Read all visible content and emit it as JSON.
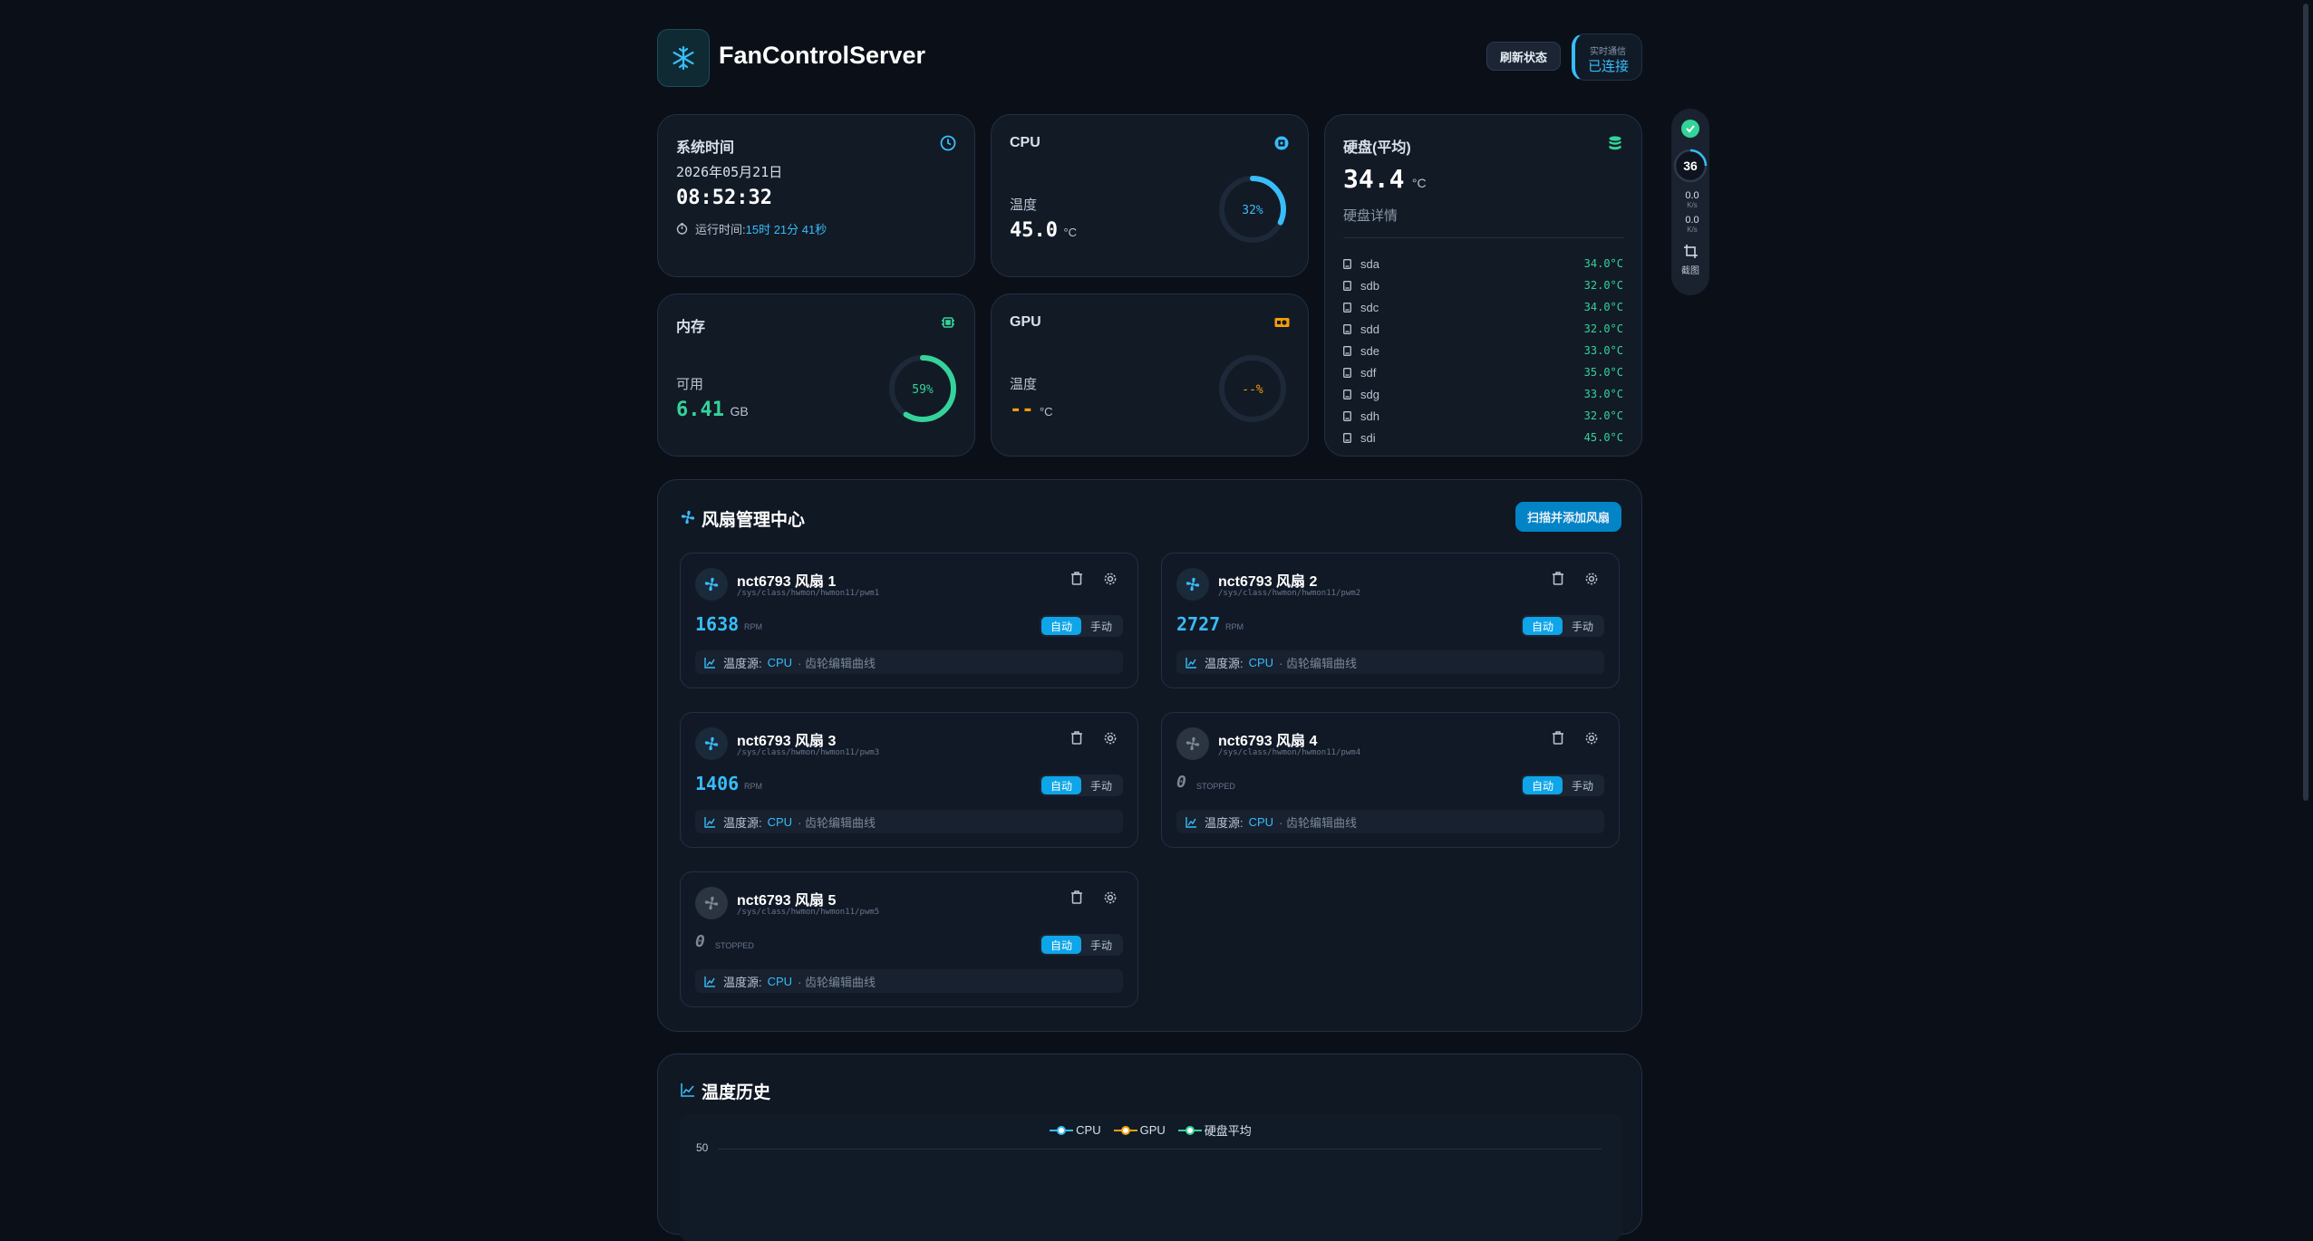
{
  "header": {
    "title": "FanControlServer",
    "refresh_label": "刷新状态",
    "realtime_label": "实时通信",
    "realtime_status": "已连接"
  },
  "colors": {
    "accent": "#38bdf8",
    "green": "#34d399",
    "orange": "#f59e0b",
    "bg": "#0b1018",
    "card": "#121a26"
  },
  "system_time": {
    "title": "系统时间",
    "date": "2026年05月21日",
    "time": "08:52:32",
    "uptime_label": "运行时间:",
    "uptime_value": "15时 21分 41秒"
  },
  "cpu": {
    "title": "CPU",
    "temp_label": "温度",
    "temp_value": "45.0",
    "temp_unit": "°C",
    "usage_text": "32%",
    "usage": 0.32
  },
  "memory": {
    "title": "内存",
    "avail_label": "可用",
    "avail_value": "6.41",
    "avail_unit": "GB",
    "usage_text": "59%",
    "usage": 0.59
  },
  "gpu": {
    "title": "GPU",
    "temp_label": "温度",
    "temp_value": "--",
    "temp_unit": "°C",
    "usage_text": "--%"
  },
  "disk": {
    "title": "硬盘(平均)",
    "avg_value": "34.4",
    "avg_unit": "°C",
    "details_label": "硬盘详情",
    "items": [
      {
        "name": "sda",
        "temp": "34.0°C"
      },
      {
        "name": "sdb",
        "temp": "32.0°C"
      },
      {
        "name": "sdc",
        "temp": "34.0°C"
      },
      {
        "name": "sdd",
        "temp": "32.0°C"
      },
      {
        "name": "sde",
        "temp": "33.0°C"
      },
      {
        "name": "sdf",
        "temp": "35.0°C"
      },
      {
        "name": "sdg",
        "temp": "33.0°C"
      },
      {
        "name": "sdh",
        "temp": "32.0°C"
      },
      {
        "name": "sdi",
        "temp": "45.0°C"
      }
    ]
  },
  "side_widget": {
    "value": "36",
    "up": "0.0",
    "up_unit": "K/s",
    "down": "0.0",
    "down_unit": "K/s",
    "screenshot_label": "截图"
  },
  "fans_panel": {
    "title": "风扇管理中心",
    "scan_label": "扫描并添加风扇",
    "auto_label": "自动",
    "manual_label": "手动",
    "rpm_unit": "RPM",
    "stopped_label": "STOPPED",
    "source_label": "温度源:",
    "source_value": "CPU",
    "curve_hint": "· 齿轮编辑曲线",
    "fans": [
      {
        "name": "nct6793 风扇 1",
        "path": "/sys/class/hwmon/hwmon11/pwm1",
        "rpm": "1638",
        "running": true
      },
      {
        "name": "nct6793 风扇 2",
        "path": "/sys/class/hwmon/hwmon11/pwm2",
        "rpm": "2727",
        "running": true
      },
      {
        "name": "nct6793 风扇 3",
        "path": "/sys/class/hwmon/hwmon11/pwm3",
        "rpm": "1406",
        "running": true
      },
      {
        "name": "nct6793 风扇 4",
        "path": "/sys/class/hwmon/hwmon11/pwm4",
        "rpm": "0",
        "running": false
      },
      {
        "name": "nct6793 风扇 5",
        "path": "/sys/class/hwmon/hwmon11/pwm5",
        "rpm": "0",
        "running": false
      }
    ]
  },
  "history": {
    "title": "温度历史",
    "chart_data": {
      "type": "line",
      "series": [
        {
          "name": "CPU",
          "color": "#38bdf8"
        },
        {
          "name": "GPU",
          "color": "#f59e0b"
        },
        {
          "name": "硬盘平均",
          "color": "#34d399"
        }
      ],
      "y_ticks": [
        "50"
      ]
    }
  }
}
